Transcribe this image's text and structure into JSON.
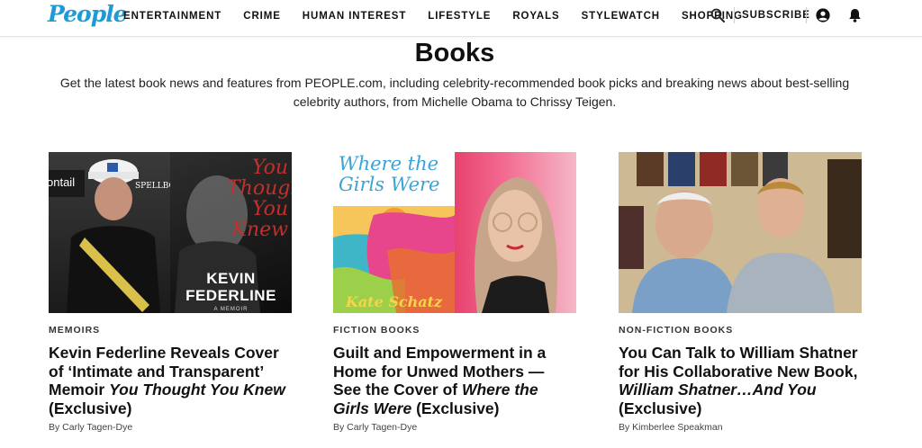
{
  "header": {
    "logo": "People",
    "nav": [
      "ENTERTAINMENT",
      "CRIME",
      "HUMAN INTEREST",
      "LIFESTYLE",
      "ROYALS",
      "STYLEWATCH",
      "SHOPPING"
    ],
    "subscribe": "SUBSCRIBE",
    "icons": {
      "search": "search-icon",
      "account": "account-icon",
      "notifications": "bell-icon"
    }
  },
  "page": {
    "title": "Books",
    "description": "Get the latest book news and features from PEOPLE.com, including celebrity-recommended book picks and breaking news about best-selling celebrity authors, from Michelle Obama to Chrissy Teigen."
  },
  "cards": [
    {
      "category": "MEMOIRS",
      "title_parts": [
        {
          "text": "Kevin Federline Reveals Cover of ‘Intimate and Transparent’ Memoir ",
          "italic": false
        },
        {
          "text": "You Thought You Knew",
          "italic": true
        },
        {
          "text": " (Exclusive)",
          "italic": false
        }
      ],
      "byline": "By Carly Tagen-Dye",
      "image_text": {
        "script": "You Thought You Knew",
        "author": "KEVIN FEDERLINE",
        "tag": "A MEMOIR"
      }
    },
    {
      "category": "FICTION BOOKS",
      "title_parts": [
        {
          "text": "Guilt and Empowerment in a Home for Unwed Mothers — See the Cover of ",
          "italic": false
        },
        {
          "text": "Where the Girls Were",
          "italic": true
        },
        {
          "text": " (Exclusive)",
          "italic": false
        }
      ],
      "byline": "By Carly Tagen-Dye",
      "image_text": {
        "script": "Where the Girls Were",
        "author": "Kate Schatz"
      }
    },
    {
      "category": "NON-FICTION BOOKS",
      "title_parts": [
        {
          "text": "You Can Talk to William Shatner for His Collaborative New Book, ",
          "italic": false
        },
        {
          "text": "William Shatner…And You",
          "italic": true
        },
        {
          "text": " (Exclusive)",
          "italic": false
        }
      ],
      "byline": "By Kimberlee Speakman"
    }
  ]
}
